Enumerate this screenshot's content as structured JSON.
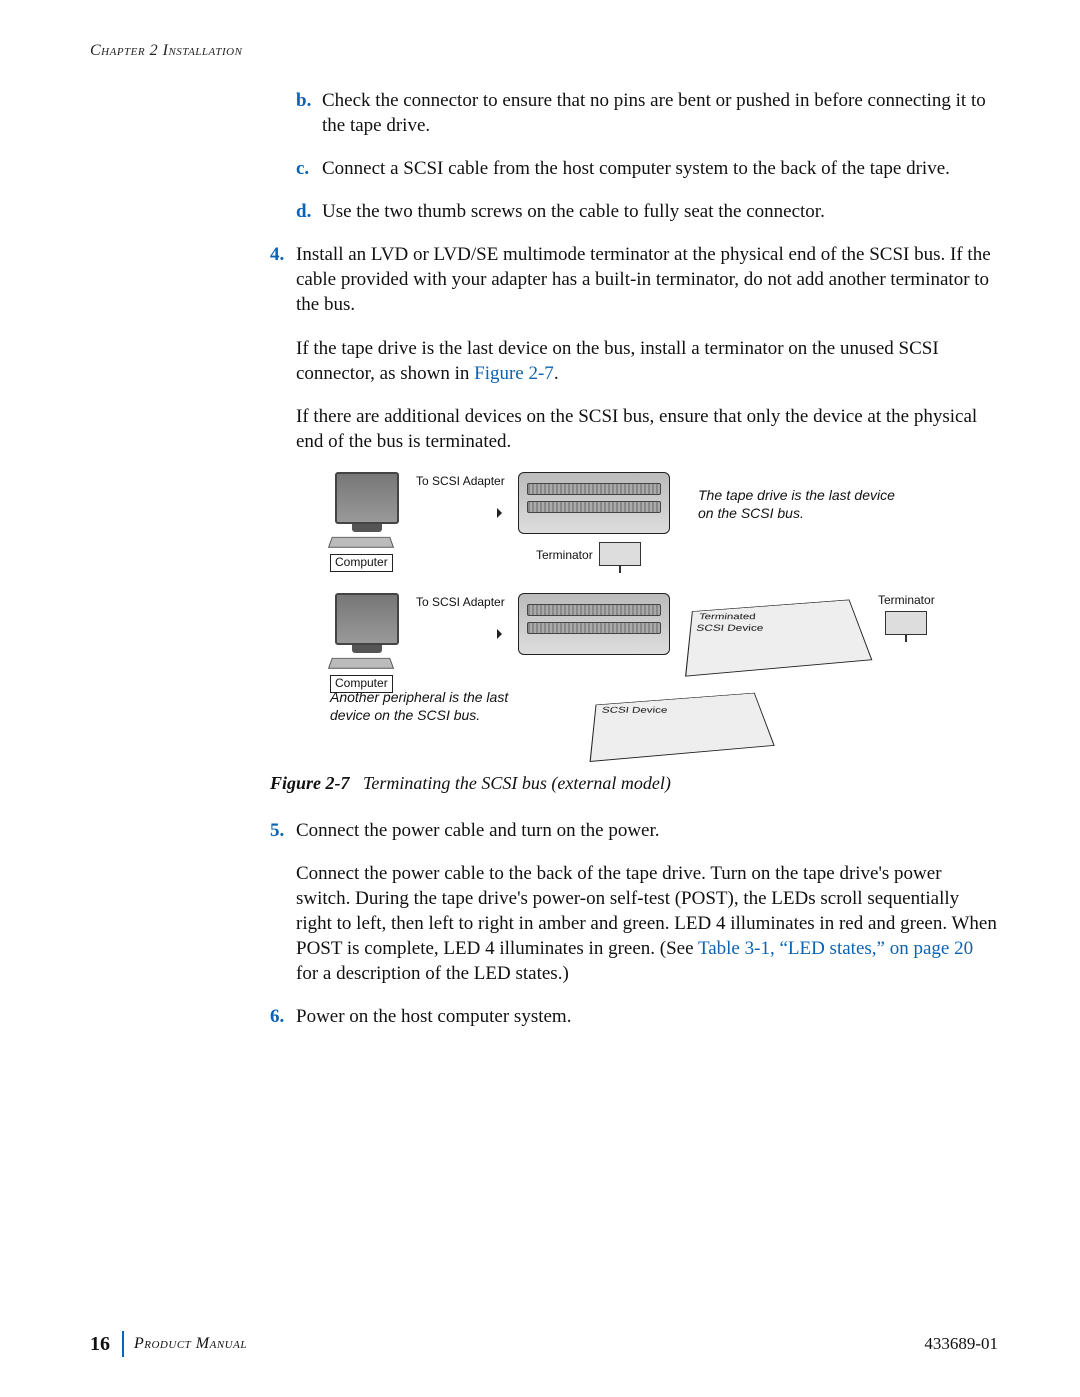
{
  "header": "Chapter 2   Installation",
  "steps_sub": [
    {
      "marker": "b.",
      "text": "Check the connector to ensure that no pins are bent or pushed in before connecting it to the tape drive."
    },
    {
      "marker": "c.",
      "text": "Connect a SCSI cable from the host computer system to the back of the tape drive."
    },
    {
      "marker": "d.",
      "text": "Use the two thumb screws on the cable to fully seat the connector."
    }
  ],
  "step4": {
    "marker": "4.",
    "text": "Install an LVD or LVD/SE multimode terminator at the physical end of the SCSI bus. If the cable provided with your adapter has a built-in terminator, do not add another terminator to the bus.",
    "p2a": "If the tape drive is the last device on the bus, install a terminator on the unused SCSI connector, as shown in ",
    "p2link": "Figure 2-7",
    "p2b": ".",
    "p3": "If there are additional devices on the SCSI bus, ensure that only the device at the physical end of the bus is terminated."
  },
  "figure": {
    "num": "Figure 2-7",
    "caption": "Terminating the SCSI bus (external model)",
    "labels": {
      "computer": "Computer",
      "to_adapter": "To SCSI Adapter",
      "terminator": "Terminator",
      "note1": "The tape drive is the last device on the SCSI bus.",
      "note2": "Another peripheral is the last device on the SCSI bus.",
      "terminated": "Terminated",
      "scsi_device": "SCSI Device"
    }
  },
  "step5": {
    "marker": "5.",
    "lead": "Connect the power cable and turn on the power.",
    "p_a": "Connect the power cable to the back of the tape drive. Turn on the tape drive's power switch. During the tape drive's power-on self-test (POST), the LEDs scroll sequentially right to left, then left to right in amber and green. LED 4 illuminates in red and green. When POST is complete, LED 4 illuminates in green. (See ",
    "p_link": "Table 3-1, “LED states,” on page 20",
    "p_b": " for a description of the LED states.)"
  },
  "step6": {
    "marker": "6.",
    "text": "Power on the host computer system."
  },
  "footer": {
    "page": "16",
    "pm": "Product Manual",
    "doc": "433689-01"
  }
}
